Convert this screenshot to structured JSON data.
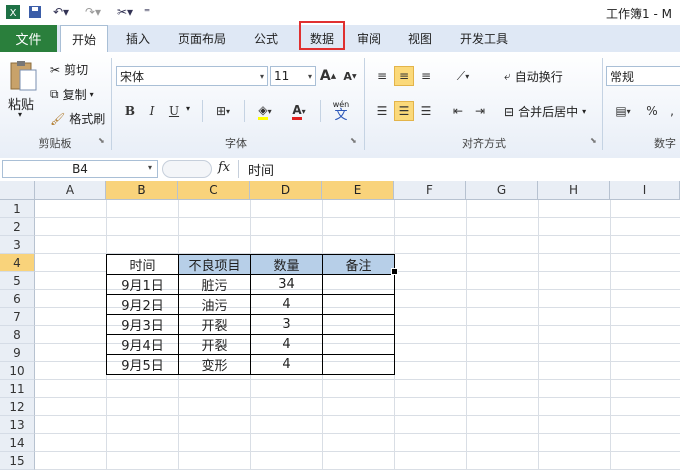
{
  "window": {
    "title": "工作簿1 - M"
  },
  "ribbon_tabs": [
    "文件",
    "开始",
    "插入",
    "页面布局",
    "公式",
    "数据",
    "审阅",
    "视图",
    "开发工具"
  ],
  "clipboard": {
    "paste": "粘贴",
    "cut": "剪切",
    "copy": "复制",
    "format_painter": "格式刷",
    "group": "剪贴板"
  },
  "font": {
    "name": "宋体",
    "size": "11",
    "bold": "B",
    "italic": "I",
    "underline": "U",
    "group": "字体",
    "grow": "A",
    "shrink": "A",
    "wen": "wén",
    "wen_char": "文"
  },
  "alignment": {
    "wrap": "自动换行",
    "merge": "合并后居中",
    "group": "对齐方式"
  },
  "number": {
    "format": "常规",
    "percent": "%",
    "comma": ",",
    "group": "数字"
  },
  "formula_bar": {
    "name_box": "B4",
    "fx": "fx",
    "value": "时间"
  },
  "columns": [
    "A",
    "B",
    "C",
    "D",
    "E",
    "F",
    "G",
    "H",
    "I"
  ],
  "rows": [
    "1",
    "2",
    "3",
    "4",
    "5",
    "6",
    "7",
    "8",
    "9",
    "10",
    "11",
    "12",
    "13",
    "14",
    "15"
  ],
  "table": {
    "headers": [
      "时间",
      "不良项目",
      "数量",
      "备注"
    ],
    "rows": [
      [
        "9月1日",
        "脏污",
        "34",
        ""
      ],
      [
        "9月2日",
        "油污",
        "4",
        ""
      ],
      [
        "9月3日",
        "开裂",
        "3",
        ""
      ],
      [
        "9月4日",
        "开裂",
        "4",
        ""
      ],
      [
        "9月5日",
        "变形",
        "4",
        ""
      ]
    ]
  },
  "colors": {
    "file_tab": "#2a7f3c",
    "highlight_box": "#e03030",
    "header_fill": "#b7cfe8",
    "selected_header": "#f9d37b"
  }
}
